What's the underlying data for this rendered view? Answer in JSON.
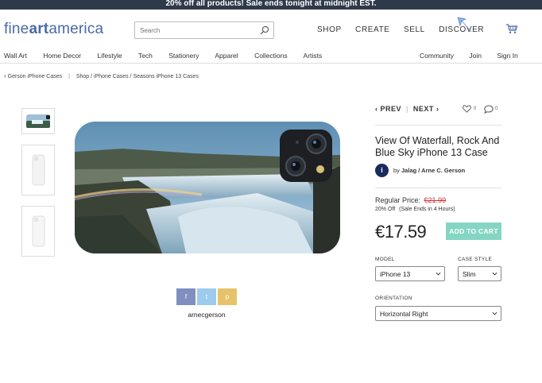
{
  "promo": {
    "text": "20% off all products!   Sale ends tonight at midnight EST."
  },
  "header": {
    "logo_pre": "fine",
    "logo_mid": "art",
    "logo_post": "america",
    "search": {
      "placeholder": "Search"
    },
    "nav": [
      "SHOP",
      "CREATE",
      "SELL",
      "DISCOVER"
    ]
  },
  "catnav": {
    "left": [
      "Wall Art",
      "Home Decor",
      "Lifestyle",
      "Tech",
      "Stationery",
      "Apparel",
      "Collections",
      "Artists"
    ],
    "right": [
      "Community",
      "Join",
      "Sign In"
    ]
  },
  "breadcrumb": {
    "back": "Gerson iPhone Cases",
    "sep": "|",
    "path": "Shop / iPhone Cases / Seasons iPhone 13 Cases"
  },
  "product": {
    "prev_label": "PREV",
    "next_label": "NEXT",
    "nav_sep": "|",
    "likes": "0",
    "comments": "0",
    "title": "View Of Waterfall, Rock And Blue Sky iPhone 13 Case",
    "by_prefix": "by",
    "artists": "Jalag / Arne C. Gerson",
    "artist_logo": "i",
    "regular_price_label": "Regular Price:",
    "regular_price": "€21.99",
    "discount": "20% Off",
    "sale_note": "(Sale Ends in 4 Hours)",
    "price": "€17.59",
    "add_to_cart": "ADD TO CART",
    "model_label": "MODEL",
    "model_value": "iPhone 13",
    "case_style_label": "CASE STYLE",
    "case_style_value": "Slim",
    "orientation_label": "ORIENTATION",
    "orientation_value": "Horizontal Right"
  },
  "share": {
    "facebook": "f",
    "twitter": "t",
    "pinterest": "p",
    "username": "arnecgerson"
  },
  "colors": {
    "promo_bg": "#2e3a4a",
    "brand_blue": "#4a6aa6",
    "add_to_cart": "#84d6c3",
    "strike_price": "#c33333"
  }
}
